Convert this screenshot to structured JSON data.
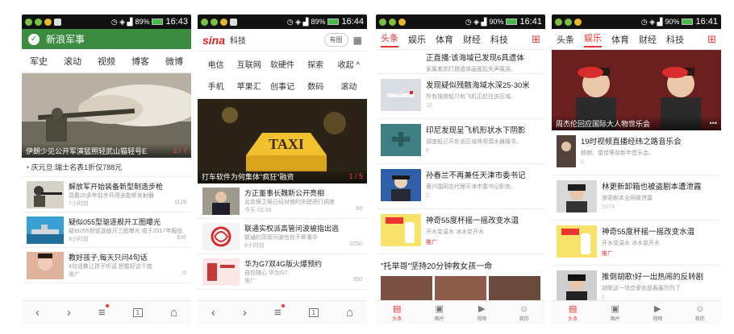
{
  "status": [
    {
      "battery": "89%",
      "time": "16:43"
    },
    {
      "battery": "89%",
      "time": "16:44"
    },
    {
      "battery": "90%",
      "time": "16:41"
    },
    {
      "battery": "90%",
      "time": "16:41"
    }
  ],
  "p1": {
    "header": "新浪军事",
    "tabs": [
      "军史",
      "滚动",
      "视频",
      "博客",
      "微博"
    ],
    "hero_caption": "伊朗少见公开军演猛照轻武山猫轻号E",
    "hero_page": "1 / 7",
    "ticker": "庆元旦:瑞士名表1折仅788元",
    "news": [
      {
        "title": "解放军开始装备新型制造步枪",
        "sub": "具备20多年前步兵用途能够发射器",
        "time": "7小时前",
        "count": "1128"
      },
      {
        "title": "疑似055型驱逐舰开工图曝光",
        "sub": "疑似055型驱逐舰开工图曝光 或于2017年服役",
        "time": "8小时前",
        "count": "836"
      },
      {
        "title": "教好孩子,每天只问4句话",
        "sub": "4句话教让孩子听话,把握好这个度",
        "time": "推广",
        "count": "0"
      }
    ],
    "nav": [
      "‹",
      "›",
      "≡",
      "1",
      "⌂"
    ]
  },
  "p2": {
    "logo": "sina",
    "crumb": "科技",
    "toggle": "有图",
    "categories": [
      "电信",
      "互联网",
      "软硬件",
      "探索",
      "收起 ^",
      "手机",
      "苹果汇",
      "创事记",
      "数码",
      "滚动"
    ],
    "hero_caption": "打车软件为何集体\"疯狂\"融资",
    "hero_page": "1 / 5",
    "taxi": "TAXI",
    "news": [
      {
        "title": "方正董事长魏新公开亮相",
        "sub": "北京保卫局已经对他的失踪进行调查",
        "time": "今天 02:39",
        "count": "93"
      },
      {
        "title": "联通实权派高管问波被指出逃",
        "sub": "联通的高管问波也在不断事中",
        "time": "8小时前",
        "count": "3250"
      },
      {
        "title": "华为G7双4G版火爆预约",
        "sub": "自在随心 华为G7",
        "time": "推广",
        "count": "350"
      }
    ],
    "nav": [
      "‹",
      "›",
      "≡",
      "1",
      "⌂"
    ]
  },
  "p3": {
    "tabs": [
      "头条",
      "娱乐",
      "体育",
      "财经",
      "科技"
    ],
    "top_cut": "正直播:该海域已发现6具遗体",
    "top_cut_sub": "家属看到打捞遗体画面后失声痛哭。",
    "news": [
      {
        "title": "发现疑似残骸海域水深25-30米",
        "sub": "所有搜救船只和飞机正赶往该区域。",
        "count": "10"
      },
      {
        "title": "印尼发现呈飞机形状水下阴影",
        "sub": "调查船已开赴该区域将用潜水器搜寻。",
        "count": "6"
      },
      {
        "title": "孙春兰不再兼任天津市委书记",
        "sub": "黄兴国同志代理天津市委书记职务。",
        "count": "0"
      },
      {
        "title": "神奇55度杯摇一摇改变水温",
        "sub": "开水变温水 冰水变开水",
        "count": "推广"
      }
    ],
    "section": "\"托举哥\"坚持20分钟救女孩一命",
    "nav": [
      "头条",
      "图片",
      "视频",
      "我的"
    ]
  },
  "p4": {
    "tabs": [
      "头条",
      "娱乐",
      "体育",
      "财经",
      "科技"
    ],
    "hero_caption": "周杰伦回应国际大人物世乐会",
    "news": [
      {
        "title": "19时视频直播经纬之路音乐会",
        "sub": "郎朗、雷佳等前新年音乐会。",
        "count": "0"
      },
      {
        "title": "林更新卸箱也被盗剧本遭泄露",
        "sub": "保密剧本全网被泄露",
        "count": "1074"
      },
      {
        "title": "神奇55度杯摇一摇改变水温",
        "sub": "开水变温水 冰水变开水",
        "count": "推广"
      },
      {
        "title": "推倒胡歌!好一出热闹的反转剧",
        "sub": "胡歌这一场恋爱也是轰轰烈烈了",
        "count": "1"
      }
    ],
    "nav": [
      "头条",
      "图片",
      "视频",
      "我的"
    ]
  }
}
